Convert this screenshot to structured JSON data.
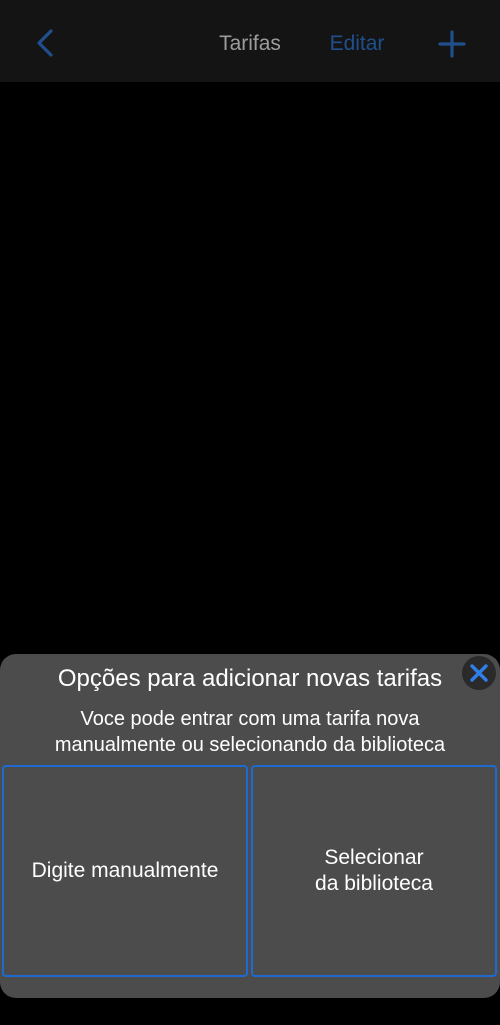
{
  "navbar": {
    "back_icon": "chevron-left-icon",
    "title": "Tarifas",
    "edit_label": "Editar",
    "add_icon": "plus-icon"
  },
  "sheet": {
    "title": "Opções para adicionar novas tarifas",
    "description_line1": "Voce pode entrar com uma tarifa nova",
    "description_line2": "manualmente ou selecionando da biblioteca",
    "close_icon": "close-icon",
    "options": [
      {
        "label": "Digite manualmente"
      },
      {
        "label": "Selecionar\nda biblioteca"
      }
    ]
  },
  "colors": {
    "accent": "#1e6ad1",
    "sheet_background": "#4c4c4c",
    "screen_background": "#000000"
  }
}
